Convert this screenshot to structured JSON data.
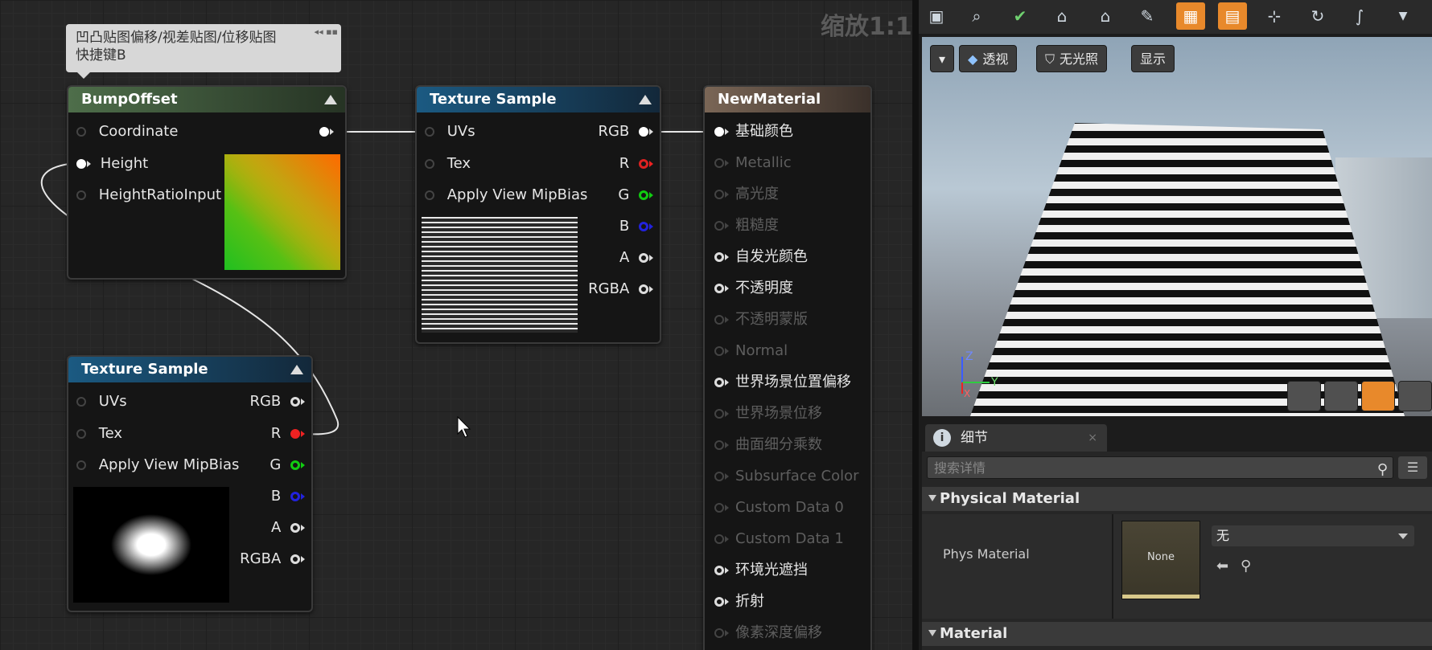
{
  "graph": {
    "zoom_label": "缩放1:1",
    "tooltip": {
      "line1": "凹凸贴图偏移/视差贴图/位移贴图",
      "line2": "快捷键B",
      "icons": "◂◂ ▪▪"
    }
  },
  "nodes": {
    "bump_offset": {
      "title": "BumpOffset",
      "inputs": [
        "Coordinate",
        "Height",
        "HeightRatioInput"
      ]
    },
    "tex_sample_top": {
      "title": "Texture Sample",
      "inputs": [
        "UVs",
        "Tex",
        "Apply View MipBias"
      ],
      "outputs": [
        "RGB",
        "R",
        "G",
        "B",
        "A",
        "RGBA"
      ]
    },
    "tex_sample_bottom": {
      "title": "Texture Sample",
      "inputs": [
        "UVs",
        "Tex",
        "Apply View MipBias"
      ],
      "outputs": [
        "RGB",
        "R",
        "G",
        "B",
        "A",
        "RGBA"
      ]
    },
    "new_material": {
      "title": "NewMaterial",
      "inputs": [
        {
          "label": "基础颜色",
          "active": true
        },
        {
          "label": "Metallic",
          "active": false
        },
        {
          "label": "高光度",
          "active": false
        },
        {
          "label": "粗糙度",
          "active": false
        },
        {
          "label": "自发光颜色",
          "active": true
        },
        {
          "label": "不透明度",
          "active": true
        },
        {
          "label": "不透明蒙版",
          "active": false
        },
        {
          "label": "Normal",
          "active": false
        },
        {
          "label": "世界场景位置偏移",
          "active": true
        },
        {
          "label": "世界场景位移",
          "active": false
        },
        {
          "label": "曲面细分乘数",
          "active": false
        },
        {
          "label": "Subsurface Color",
          "active": false
        },
        {
          "label": "Custom Data 0",
          "active": false
        },
        {
          "label": "Custom Data 1",
          "active": false
        },
        {
          "label": "环境光遮挡",
          "active": true
        },
        {
          "label": "折射",
          "active": true
        },
        {
          "label": "像素深度偏移",
          "active": false
        }
      ]
    }
  },
  "toolbar": {
    "icons": [
      "save-icon",
      "search-icon",
      "apply-icon",
      "home-icon",
      "clean-icon",
      "stats-icon",
      "preview-icon",
      "hierarchy-icon",
      "live-update-icon",
      "curve-icon"
    ],
    "active_indices": [
      6,
      7
    ],
    "accent": "#e8892b"
  },
  "viewport": {
    "menu_icon": "chevron-down-icon",
    "perspective_label": "透视",
    "unlit_label": "无光照",
    "show_label": "显示",
    "axis_z": "Z",
    "axis_y": "Y",
    "axis_x": "X"
  },
  "details": {
    "tab_label": "细节",
    "tab_close": "×",
    "search_placeholder": "搜索详情",
    "sections": {
      "physical_material": "Physical Material",
      "material": "Material"
    },
    "phys_material_label": "Phys Material",
    "thumb_label": "None",
    "selected_value": "无"
  }
}
